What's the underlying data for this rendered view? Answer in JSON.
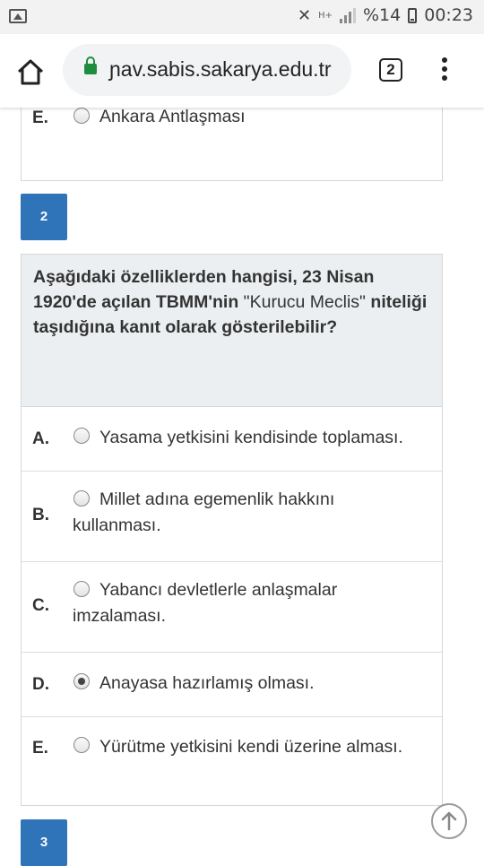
{
  "status_bar": {
    "battery_percent": "%14",
    "time": "00:23",
    "network": "H+"
  },
  "browser": {
    "url": "ɲav.sabis.sakarya.edu.tr",
    "tab_count": "2",
    "secure_color": "#1e8e3e"
  },
  "previous_question": {
    "visible_option": {
      "letter": "E.",
      "text": "Ankara Antlaşması",
      "selected": false
    }
  },
  "question_2": {
    "number": "2",
    "text_parts": [
      {
        "text": "Aşağıdaki özelliklerden hangisi, 23 Nisan 1920'de açılan TBMM'nin ",
        "bold": true
      },
      {
        "text": "\"Kurucu Meclis\"",
        "bold": false
      },
      {
        "text": " niteliği taşıdığına kanıt olarak gösterilebilir?",
        "bold": true
      }
    ],
    "options": [
      {
        "letter": "A.",
        "text": "Yasama yetkisini kendisinde toplaması.",
        "selected": false
      },
      {
        "letter": "B.",
        "text_line1": "Millet adına egemenlik hakkını",
        "text_line2": "kullanması.",
        "selected": false
      },
      {
        "letter": "C.",
        "text_line1": "Yabancı devletlerle anlaşmalar",
        "text_line2": "imzalaması.",
        "selected": false
      },
      {
        "letter": "D.",
        "text": "Anayasa hazırlamış olması.",
        "selected": true
      },
      {
        "letter": "E.",
        "text": "Yürütme yetkisini kendi üzerine alması.",
        "selected": false
      }
    ]
  },
  "question_3": {
    "number": "3"
  },
  "colors": {
    "accent": "#2f73b8",
    "question_header_bg": "#eceff1"
  }
}
